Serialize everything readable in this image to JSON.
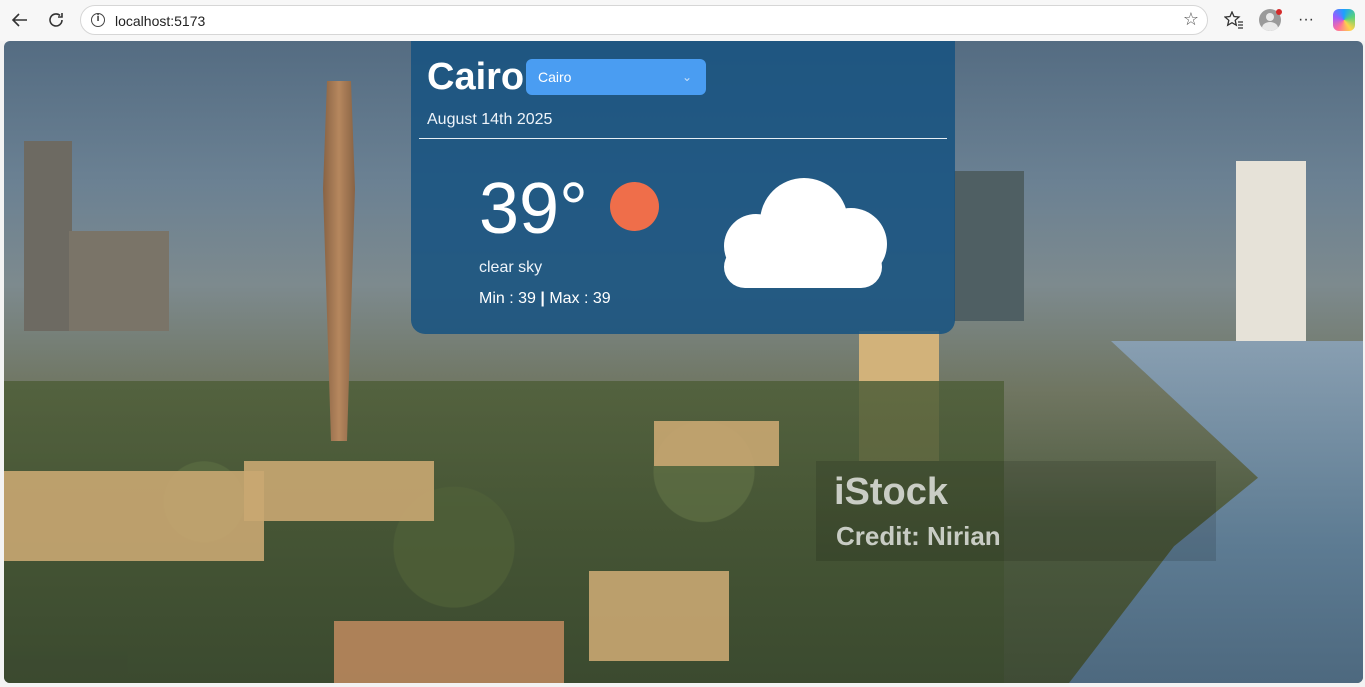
{
  "browser": {
    "url": "localhost:5173",
    "icons": [
      "back-arrow-icon",
      "refresh-icon",
      "info-icon",
      "star-icon",
      "favorites-icon",
      "profile-icon",
      "more-icon",
      "copilot-icon"
    ]
  },
  "weather": {
    "city": "Cairo",
    "selected_city": "Cairo",
    "date": "August 14th 2025",
    "temperature": "39°",
    "description": "clear sky",
    "min_label": "Min : 39",
    "separator": "|",
    "max_label": "Max : 39",
    "icon": "cloud-icon",
    "accent_color": "#ef6e4a",
    "select_color": "#4a9df2"
  },
  "background": {
    "watermark_brand": "iStock",
    "watermark_credit": "Credit: Nirian"
  }
}
